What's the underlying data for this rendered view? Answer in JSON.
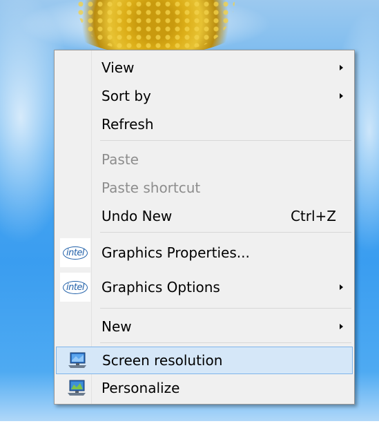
{
  "context_menu": {
    "items": [
      {
        "label": "View",
        "submenu": true
      },
      {
        "label": "Sort by",
        "submenu": true
      },
      {
        "label": "Refresh"
      },
      {
        "label": "Paste",
        "disabled": true
      },
      {
        "label": "Paste shortcut",
        "disabled": true
      },
      {
        "label": "Undo New",
        "shortcut": "Ctrl+Z"
      },
      {
        "label": "Graphics Properties...",
        "icon": "intel-icon"
      },
      {
        "label": "Graphics Options",
        "icon": "intel-icon",
        "submenu": true
      },
      {
        "label": "New",
        "submenu": true
      },
      {
        "label": "Screen resolution",
        "icon": "monitor-icon",
        "highlighted": true
      },
      {
        "label": "Personalize",
        "icon": "monitor-icon"
      }
    ],
    "intel_icon_text": "intel",
    "highlight_color": "#d5e7f8",
    "highlight_border": "#7eb4ea"
  }
}
